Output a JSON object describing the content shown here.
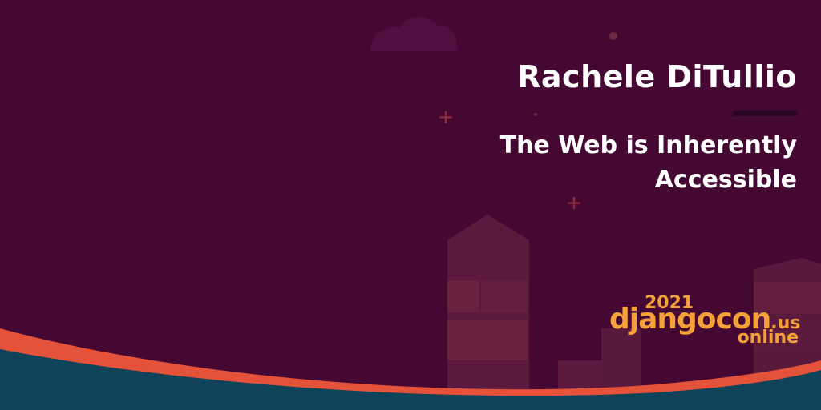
{
  "speaker": {
    "name": "Rachele DiTullio"
  },
  "talk": {
    "title_line1": "The Web is Inherently",
    "title_line2": "Accessible"
  },
  "logo": {
    "year": "2021",
    "brand": "djangocon",
    "tld": ".us",
    "subtitle": "online"
  },
  "colors": {
    "background": "#440833",
    "accent": "#f5a13a",
    "wave_orange": "#e5523a",
    "wave_teal": "#0f4359",
    "text": "#ffffff"
  }
}
